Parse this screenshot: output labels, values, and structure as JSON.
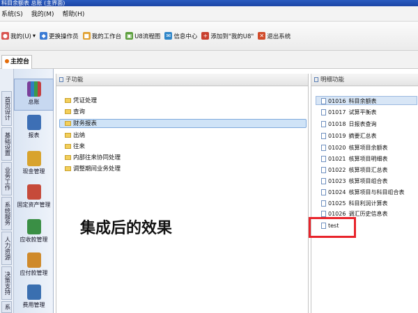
{
  "window": {
    "title": "科目余额表 总账 (主界面)"
  },
  "menu": [
    "系统(S)",
    "我的(M)",
    "帮助(H)"
  ],
  "toolbar": [
    {
      "label": "我的(U)",
      "icon": "user-icon",
      "color": "#d9534f"
    },
    {
      "label": "更换操作员",
      "icon": "operator-icon",
      "color": "#3a7bd5"
    },
    {
      "label": "我的工作台",
      "icon": "workbench-icon",
      "color": "#e0a030"
    },
    {
      "label": "U8流程图",
      "icon": "flowchart-icon",
      "color": "#5a9e3a"
    },
    {
      "label": "信息中心",
      "icon": "info-center-icon",
      "color": "#2f86c9"
    },
    {
      "label": "添加到\"我的U8\"",
      "icon": "add-favorite-icon",
      "color": "#c9402f"
    },
    {
      "label": "退出系统",
      "icon": "exit-icon",
      "color": "#d14b2a"
    }
  ],
  "tabs": [
    {
      "label": "主控台"
    }
  ],
  "vertical_nav": [
    {
      "label": "首页设计"
    },
    {
      "label": "基础设置"
    },
    {
      "label": "业务工作"
    },
    {
      "label": "系统服务"
    },
    {
      "label": "人力资源"
    },
    {
      "label": "决策支持"
    },
    {
      "label": "系统设置"
    }
  ],
  "nav_icons": [
    {
      "label": "总账",
      "icon": "ledger-books-icon",
      "color": "#6a4a9c"
    },
    {
      "label": "报表",
      "icon": "report-icon",
      "color": "#3d6fb5"
    },
    {
      "label": "现金管理",
      "icon": "cash-icon",
      "color": "#d8a32c"
    },
    {
      "label": "固定资产管理",
      "icon": "fixed-asset-icon",
      "color": "#c64a3a"
    },
    {
      "label": "应收款管理",
      "icon": "receivable-icon",
      "color": "#3a8f45"
    },
    {
      "label": "应付款管理",
      "icon": "payable-icon",
      "color": "#cf8a2b"
    },
    {
      "label": "费用管理",
      "icon": "expense-icon",
      "color": "#3a6fb0"
    }
  ],
  "sub_panel": {
    "header": "子功能",
    "folders": [
      "凭证处理",
      "查询",
      "财务报表",
      "出纳",
      "往来",
      "内部往来协同处理",
      "调整期间业务处理"
    ],
    "selected_index": 2
  },
  "detail_panel": {
    "header": "明细功能",
    "items": [
      {
        "code": "01016",
        "name": "科目余额表"
      },
      {
        "code": "01017",
        "name": "试算平衡表"
      },
      {
        "code": "01018",
        "name": "日报表查询"
      },
      {
        "code": "01019",
        "name": "摘要汇总表"
      },
      {
        "code": "01020",
        "name": "核算项目余额表"
      },
      {
        "code": "01021",
        "name": "核算项目明细表"
      },
      {
        "code": "01022",
        "name": "核算项目汇总表"
      },
      {
        "code": "01023",
        "name": "核算项目组合表"
      },
      {
        "code": "01024",
        "name": "核算项目与科目组合表"
      },
      {
        "code": "01025",
        "name": "科目利润计算表"
      },
      {
        "code": "01026",
        "name": "调汇历史信息表"
      },
      {
        "code": "",
        "name": "test"
      }
    ],
    "selected_index": 0
  },
  "caption": "集成后的效果",
  "accent": "#e8232a"
}
